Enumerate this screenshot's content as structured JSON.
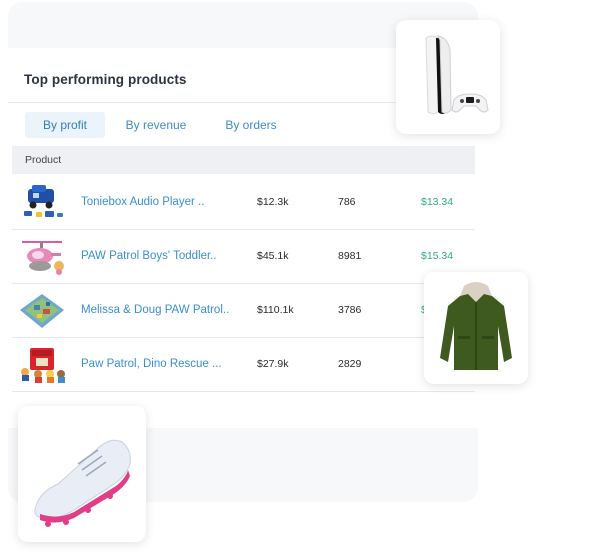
{
  "widget": {
    "title": "Top performing products",
    "tabs": [
      {
        "label": "By profit",
        "active": true
      },
      {
        "label": "By revenue",
        "active": false
      },
      {
        "label": "By orders",
        "active": false
      }
    ],
    "table": {
      "header": "Product",
      "rows": [
        {
          "product": "Toniebox Audio Player ..",
          "revenue": "$12.3k",
          "orders": "786",
          "profit": "$13.34",
          "thumb": "blue-toy-truck"
        },
        {
          "product": "PAW Patrol Boys' Toddler..",
          "revenue": "$45.1k",
          "orders": "8981",
          "profit": "$15.34",
          "thumb": "toy-helicopter"
        },
        {
          "product": "Melissa & Doug PAW Patrol..",
          "revenue": "$110.1k",
          "orders": "3786",
          "profit": "$",
          "thumb": "play-mat"
        },
        {
          "product": "Paw Patrol, Dino Rescue ...",
          "revenue": "$27.9k",
          "orders": "2829",
          "profit": "",
          "thumb": "red-playset"
        }
      ]
    }
  },
  "floating_cards": [
    {
      "item": "game-console-with-controller"
    },
    {
      "item": "green-hooded-jacket"
    },
    {
      "item": "white-pink-sneaker"
    }
  ],
  "colors": {
    "link": "#3a8fd2",
    "profit": "#27b07a",
    "tab_active_bg": "#ecf4fb",
    "header_bg": "#eef0f3"
  }
}
